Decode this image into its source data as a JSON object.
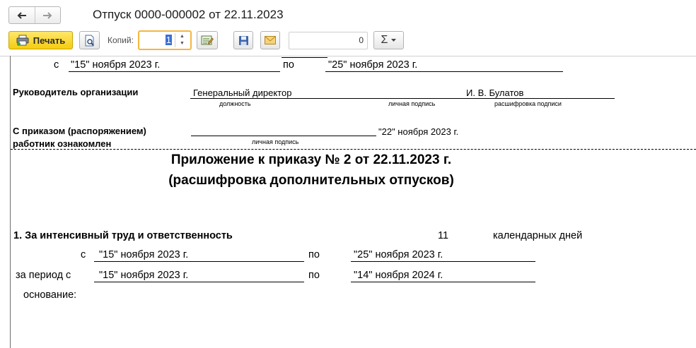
{
  "window": {
    "title": "Отпуск 0000-000002 от 22.11.2023"
  },
  "nav": {
    "back": "back-arrow-icon",
    "forward": "forward-arrow-icon"
  },
  "toolbar": {
    "print_label": "Печать",
    "copies_label": "Копий:",
    "copies_value": "1",
    "counter_value": "0",
    "sum_label": "Σ",
    "icons": [
      "printer-icon",
      "preview-icon",
      "edit-icon",
      "save-icon",
      "mail-icon",
      "chevron-down-icon"
    ]
  },
  "doc": {
    "period_top": {
      "from_prefix": "с",
      "from_date": "\"15\" ноября 2023 г.",
      "to_prefix": "по",
      "to_date": "\"25\" ноября 2023 г."
    },
    "head": {
      "label": "Руководитель организации",
      "position": "Генеральный директор",
      "name": "И. В. Булатов",
      "caption_position": "должность",
      "caption_signature": "личная подпись",
      "caption_decoding": "расшифровка подписи"
    },
    "acquainted": {
      "line1": "С приказом (распоряжением)",
      "line2": "работник  ознакомлен",
      "date": "\"22\" ноября 2023 г.",
      "caption_signature": "личная подпись"
    },
    "appendix": {
      "title1": "Приложение к приказу № 2 от 22.11.2023 г.",
      "title2": "(расшифровка дополнительных отпусков)"
    },
    "item": {
      "title": "1. За интенсивный труд и ответственность",
      "days": "11",
      "days_unit": "календарных дней",
      "from_prefix": "с",
      "from_date": "\"15\" ноября 2023 г.",
      "to_prefix": "по",
      "to_date": "\"25\" ноября 2023 г.",
      "period_prefix": "за период  с",
      "period_from": "\"15\" ноября 2023 г.",
      "period_to_prefix": "по",
      "period_to": "\"14\" ноября 2024 г.",
      "basis_label": "основание:"
    }
  }
}
